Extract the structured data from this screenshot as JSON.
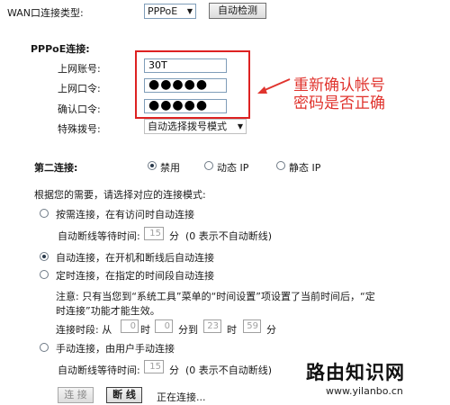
{
  "wan": {
    "type_label": "WAN口连接类型:",
    "type_value": "PPPoE",
    "auto_detect": "自动检测"
  },
  "pppoe": {
    "section_title": "PPPoE连接:",
    "account_label": "上网账号:",
    "account_value": "30T",
    "password_label": "上网口令:",
    "password_value": "●●●●●",
    "confirm_label": "确认口令:",
    "confirm_value": "●●●●●",
    "dial_label": "特殊拨号:",
    "dial_value": "自动选择拨号模式"
  },
  "annotation": {
    "line1": "重新确认帐号",
    "line2": "密码是否正确",
    "color": "#e0342e"
  },
  "second": {
    "label": "第二连接:",
    "options": [
      "禁用",
      "动态 IP",
      "静态 IP"
    ],
    "selected": 0
  },
  "mode": {
    "intro": "根据您的需要，请选择对应的连接模式:",
    "on_demand": "按需连接，在有访问时自动连接",
    "idle_label": "自动断线等待时间:",
    "idle_value": "15",
    "idle_unit": "分",
    "idle_note": "(0 表示不自动断线)",
    "auto": "自动连接，在开机和断线后自动连接",
    "timed": "定时连接，在指定的时间段自动连接",
    "note_line1": "注意: 只有当您到“系统工具”菜单的“时间设置”项设置了当前时间后，“定",
    "note_line2": "时连接”功能才能生效。",
    "period_label": "连接时段: 从",
    "period_from_h": "0",
    "hour_unit": "时",
    "period_from_m": "0",
    "to_label": "分到",
    "period_to_h": "23",
    "period_to_m": "59",
    "min_unit": "分",
    "manual": "手动连接，由用户手动连接",
    "idle2_value": "15",
    "selected": "auto"
  },
  "actions": {
    "connect": "连 接",
    "disconnect": "断 线",
    "status": "正在连接..."
  },
  "watermark": {
    "title": "路由知识网",
    "url": "www.yilanbo.cn"
  }
}
